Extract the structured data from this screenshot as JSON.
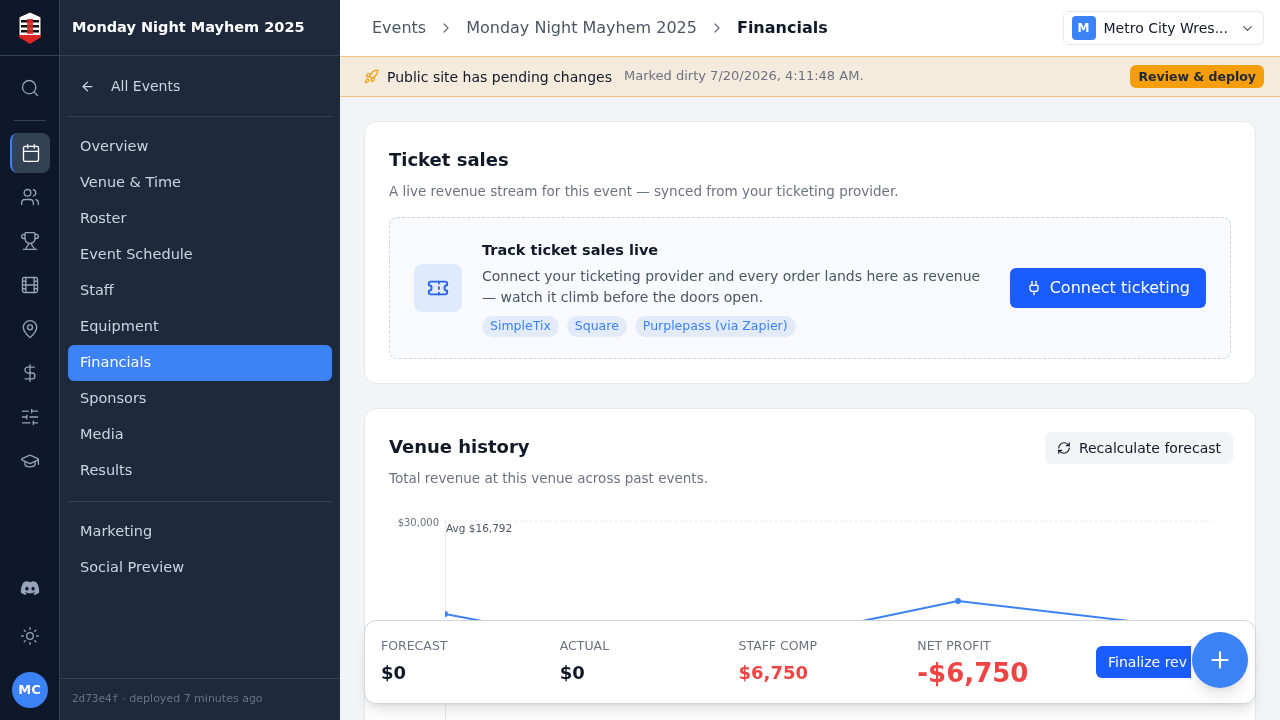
{
  "rail": {
    "top": [
      {
        "kind": "search",
        "selected": false
      }
    ],
    "items": [
      {
        "kind": "calendar",
        "selected": true
      },
      {
        "kind": "users",
        "selected": false
      },
      {
        "kind": "trophy",
        "selected": false
      },
      {
        "kind": "film",
        "selected": false
      },
      {
        "kind": "pin",
        "selected": false
      },
      {
        "kind": "dollar",
        "selected": false
      },
      {
        "kind": "sliders",
        "selected": false
      },
      {
        "kind": "cap",
        "selected": false
      }
    ],
    "bottom": [
      {
        "kind": "discord"
      },
      {
        "kind": "sun"
      }
    ],
    "avatar": "MC"
  },
  "sidebar": {
    "title": "Monday Night Mayhem 2025",
    "back": "All Events",
    "groups": [
      [
        {
          "label": "Overview",
          "selected": false
        },
        {
          "label": "Venue & Time",
          "selected": false
        },
        {
          "label": "Roster",
          "selected": false
        },
        {
          "label": "Event Schedule",
          "selected": false
        },
        {
          "label": "Staff",
          "selected": false
        },
        {
          "label": "Equipment",
          "selected": false
        },
        {
          "label": "Financials",
          "selected": true
        },
        {
          "label": "Sponsors",
          "selected": false
        },
        {
          "label": "Media",
          "selected": false
        },
        {
          "label": "Results",
          "selected": false
        }
      ],
      [
        {
          "label": "Marketing",
          "selected": false
        },
        {
          "label": "Social Preview",
          "selected": false
        }
      ]
    ],
    "footer_hash": "2d73e4f",
    "footer_text": "· deployed 7 minutes ago"
  },
  "breadcrumbs": [
    "Events",
    "Monday Night Mayhem 2025",
    "Financials"
  ],
  "org": {
    "initial": "M",
    "name": "Metro City Wres..."
  },
  "banner": {
    "title": "Public site has pending changes",
    "detail": "Marked dirty 7/20/2026, 4:11:48 AM.",
    "button": "Review & deploy"
  },
  "ticket_sales": {
    "title": "Ticket sales",
    "subtitle": "A live revenue stream for this event — synced from your ticketing provider.",
    "cta_title": "Track ticket sales live",
    "cta_text": "Connect your ticketing provider and every order lands here as revenue — watch it climb before the doors open.",
    "providers": [
      "SimpleTix",
      "Square",
      "Purplepass (via Zapier)"
    ],
    "button": "Connect ticketing"
  },
  "venue_history": {
    "title": "Venue history",
    "subtitle": "Total revenue at this venue across past events.",
    "button": "Recalculate forecast",
    "tick": "$30,000",
    "avg_label": "Avg $16,792"
  },
  "summary": {
    "stats": [
      {
        "label": "FORECAST",
        "value": "$0",
        "kind": "plain"
      },
      {
        "label": "ACTUAL",
        "value": "$0",
        "kind": "plain"
      },
      {
        "label": "STAFF COMP",
        "value": "$6,750",
        "kind": "negative"
      },
      {
        "label": "NET PROFIT",
        "value": "-$6,750",
        "kind": "negative_large"
      }
    ],
    "button": "Finalize rev"
  }
}
